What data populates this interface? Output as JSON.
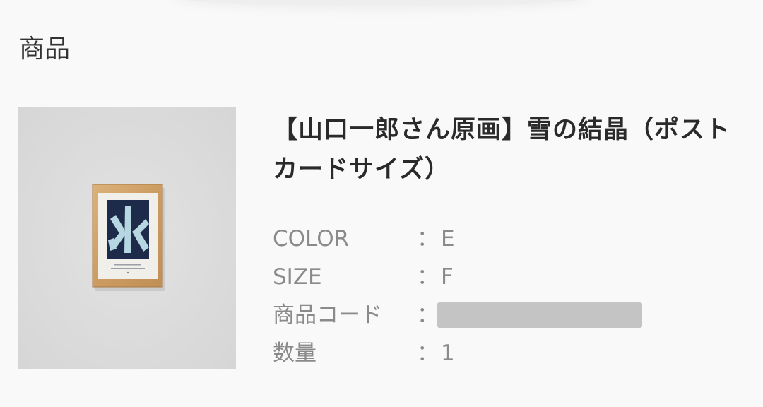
{
  "section": {
    "heading": "商品"
  },
  "product": {
    "title": "【山口一郎さん原画】雪の結晶（ポストカードサイズ）",
    "image_alt": "framed snowflake artwork",
    "details": [
      {
        "label": "COLOR",
        "separator": "：",
        "value": "E"
      },
      {
        "label": "SIZE",
        "separator": "：",
        "value": "F"
      },
      {
        "label": "商品コード",
        "separator": "：",
        "value": ""
      },
      {
        "label": "数量",
        "separator": "：",
        "value": "1"
      }
    ]
  },
  "colors": {
    "background": "#f9f9f9",
    "image_background": "#dcdcdc",
    "frame_wood": "#d2a66e",
    "artwork_navy": "#1d2a4a",
    "redaction": "#c4c4c4"
  }
}
